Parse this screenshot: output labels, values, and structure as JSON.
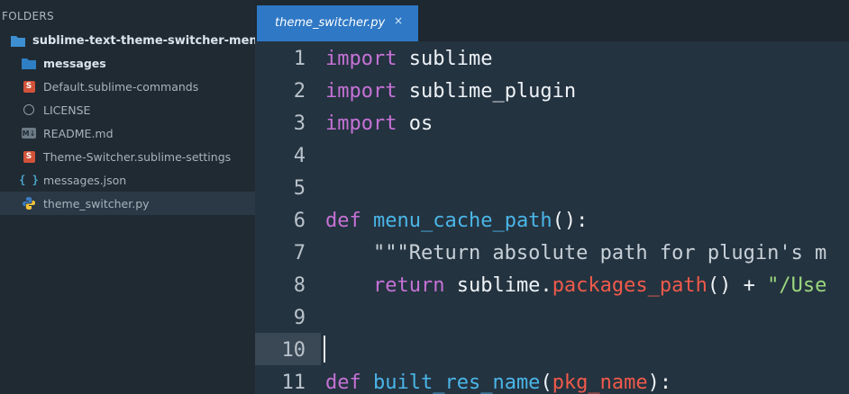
{
  "sidebar": {
    "title": "FOLDERS",
    "root": "sublime-text-theme-switcher-menu",
    "items": [
      {
        "label": "messages",
        "kind": "folder"
      },
      {
        "label": "Default.sublime-commands",
        "kind": "sublime"
      },
      {
        "label": "LICENSE",
        "kind": "file"
      },
      {
        "label": "README.md",
        "kind": "markdown"
      },
      {
        "label": "Theme-Switcher.sublime-settings",
        "kind": "sublime"
      },
      {
        "label": "messages.json",
        "kind": "json"
      },
      {
        "label": "theme_switcher.py",
        "kind": "python",
        "selected": true
      }
    ],
    "badges": {
      "s": "S",
      "md": "M↓",
      "json": "{ }"
    }
  },
  "tab": {
    "label": "theme_switcher.py",
    "close": "×"
  },
  "editor": {
    "line_numbers": [
      "1",
      "2",
      "3",
      "4",
      "5",
      "6",
      "7",
      "8",
      "9",
      "10",
      "11"
    ],
    "current_line": 10,
    "lines": [
      [
        {
          "t": "import",
          "c": "kw"
        },
        {
          "t": " sublime",
          "c": "plain"
        }
      ],
      [
        {
          "t": "import",
          "c": "kw"
        },
        {
          "t": " sublime_plugin",
          "c": "plain"
        }
      ],
      [
        {
          "t": "import",
          "c": "kw"
        },
        {
          "t": " os",
          "c": "plain"
        }
      ],
      [],
      [],
      [
        {
          "t": "def",
          "c": "kw"
        },
        {
          "t": " ",
          "c": "plain"
        },
        {
          "t": "menu_cache_path",
          "c": "fn"
        },
        {
          "t": "():",
          "c": "plain"
        }
      ],
      [
        {
          "t": "    ",
          "c": "plain"
        },
        {
          "t": "\"\"\"Return absolute path for plugin's m",
          "c": "doc"
        }
      ],
      [
        {
          "t": "    ",
          "c": "plain"
        },
        {
          "t": "return",
          "c": "kw"
        },
        {
          "t": " sublime.",
          "c": "plain"
        },
        {
          "t": "packages_path",
          "c": "call"
        },
        {
          "t": "() + ",
          "c": "plain"
        },
        {
          "t": "\"/Use",
          "c": "str"
        }
      ],
      [],
      [],
      [
        {
          "t": "def",
          "c": "kw"
        },
        {
          "t": " ",
          "c": "plain"
        },
        {
          "t": "built_res_name",
          "c": "fn"
        },
        {
          "t": "(",
          "c": "plain"
        },
        {
          "t": "pkg_name",
          "c": "param"
        },
        {
          "t": "):",
          "c": "plain"
        }
      ]
    ]
  },
  "colors": {
    "sidebar_bg": "#202a33",
    "editor_bg": "#243340",
    "tab_active": "#2f78c5",
    "keyword": "#c572d6",
    "function": "#4ab6e8",
    "call": "#f05a4a",
    "string": "#9bd87e"
  }
}
